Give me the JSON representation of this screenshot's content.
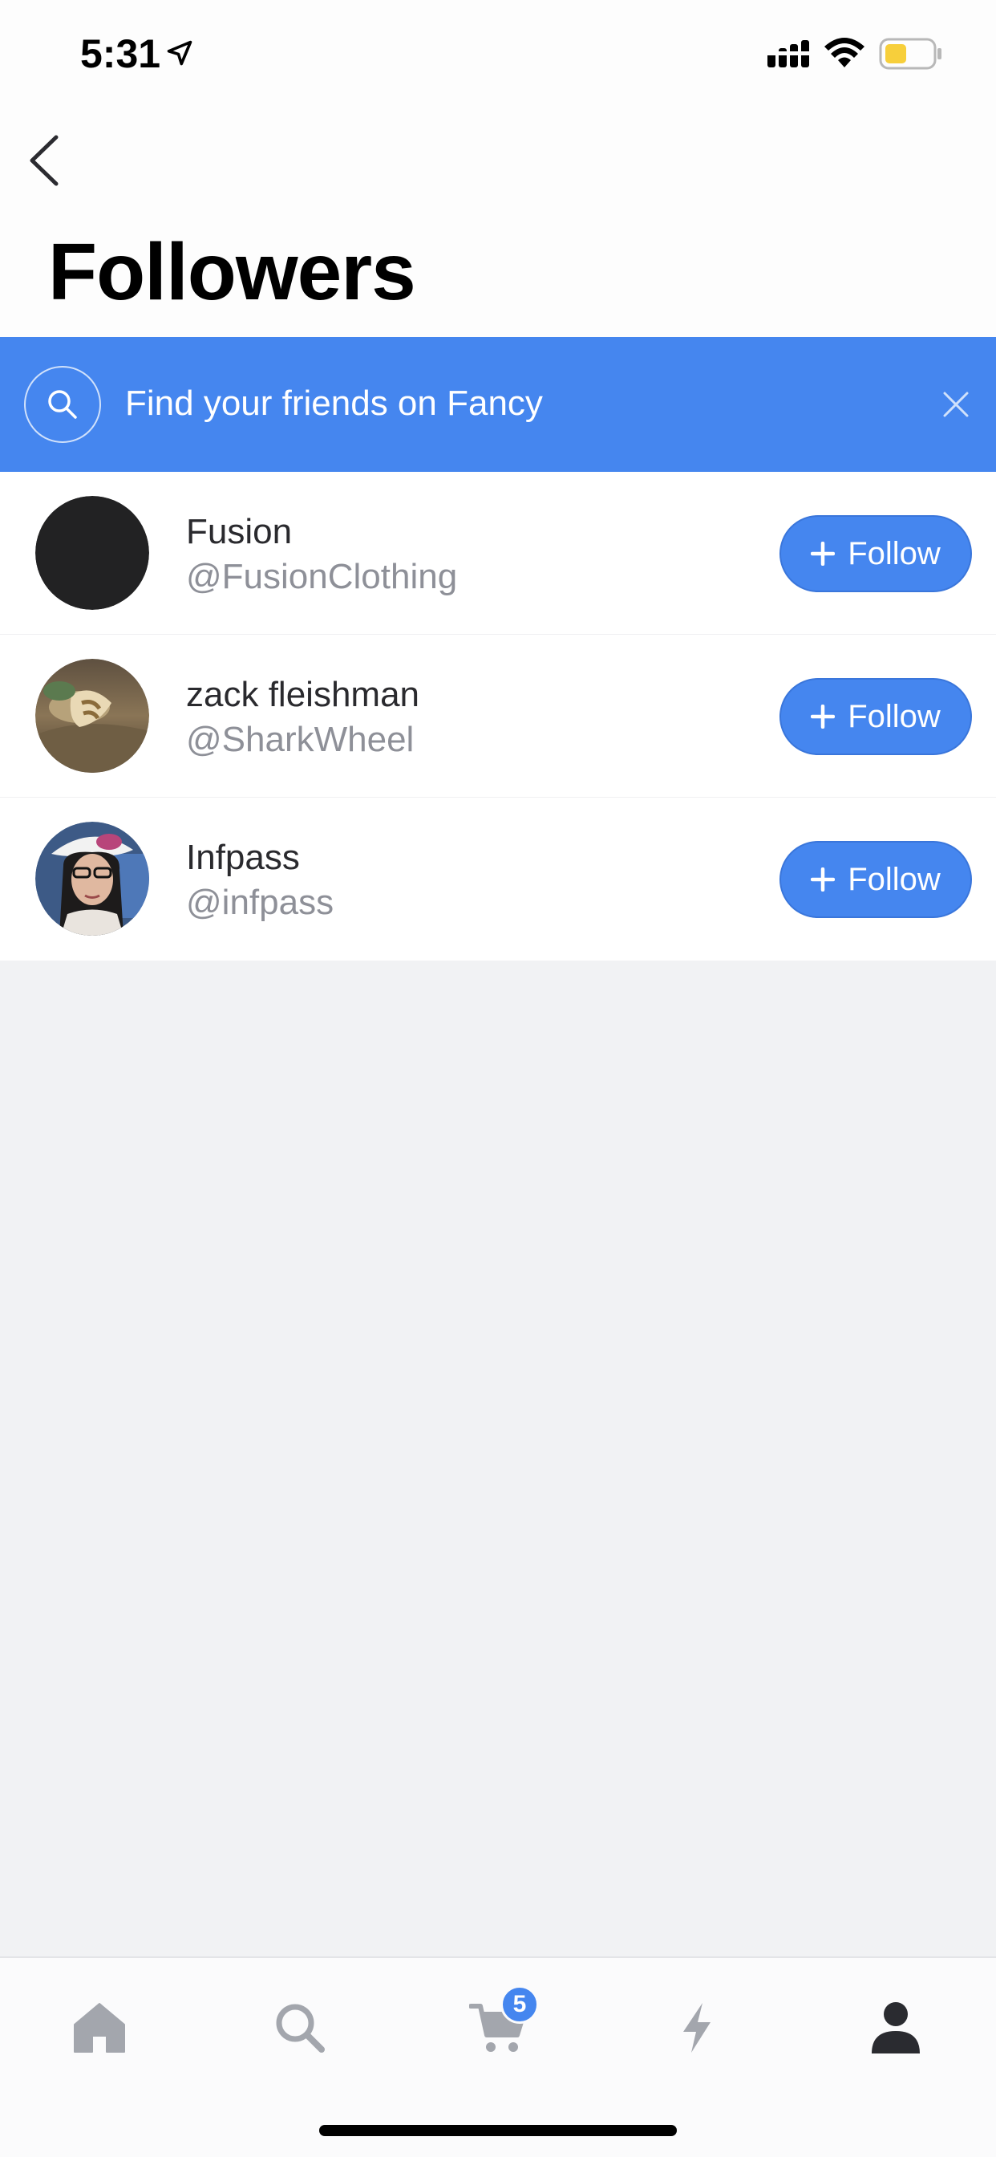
{
  "status_bar": {
    "time": "5:31"
  },
  "header": {
    "title": "Followers"
  },
  "find_banner": {
    "text": "Find your friends on Fancy"
  },
  "followers": [
    {
      "name": "Fusion",
      "handle": "@FusionClothing",
      "button": "Follow"
    },
    {
      "name": "zack fleishman",
      "handle": "@SharkWheel",
      "button": "Follow"
    },
    {
      "name": "Infpass",
      "handle": "@infpass",
      "button": "Follow"
    }
  ],
  "tab_bar": {
    "items": [
      "home-icon",
      "search-icon",
      "cart-icon",
      "bolt-icon",
      "profile-icon"
    ],
    "cart_badge": "5",
    "active": "profile-icon"
  },
  "colors": {
    "accent": "#4586ef",
    "background": "#f1f2f4",
    "tab_inactive": "#a3a6ad",
    "tab_active": "#2a2b30"
  }
}
